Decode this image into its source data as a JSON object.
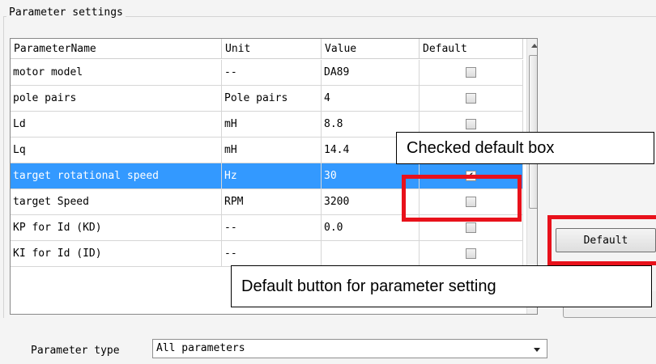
{
  "group": {
    "title": "Parameter settings"
  },
  "table": {
    "headers": [
      "ParameterName",
      "Unit",
      "Value",
      "Default"
    ],
    "rows": [
      {
        "name": "motor model",
        "unit": "--",
        "value": "DA89",
        "default": false
      },
      {
        "name": "pole pairs",
        "unit": "Pole pairs",
        "value": "4",
        "default": false
      },
      {
        "name": "Ld",
        "unit": "mH",
        "value": "8.8",
        "default": false
      },
      {
        "name": "Lq",
        "unit": "mH",
        "value": "14.4",
        "default": false
      },
      {
        "name": "target rotational speed",
        "unit": "Hz",
        "value": "30",
        "default": true,
        "selected": true
      },
      {
        "name": "target Speed",
        "unit": "RPM",
        "value": "3200",
        "default": false
      },
      {
        "name": "KP for Id (KD)",
        "unit": "--",
        "value": "0.0",
        "default": false
      },
      {
        "name": "KI for Id (ID)",
        "unit": "--",
        "value": "",
        "default": false
      }
    ]
  },
  "annotations": {
    "checked_box": "Checked default box",
    "default_button": "Default button for parameter setting"
  },
  "buttons": {
    "default_label": "Default"
  },
  "parameter_type": {
    "label": "Parameter type",
    "selected": "All parameters"
  },
  "colors": {
    "selection": "#3399ff",
    "highlight": "#e8111b"
  },
  "icons": {
    "checkbox_checked": "checkmark",
    "scroll_up": "arrow-up-icon",
    "dropdown": "chevron-down-icon"
  }
}
